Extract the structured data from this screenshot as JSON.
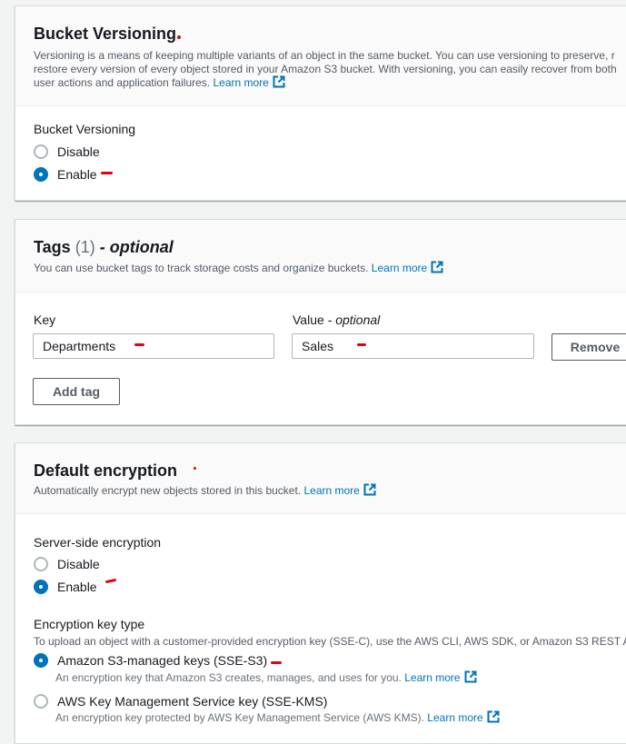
{
  "versioning": {
    "title": "Bucket Versioning",
    "desc_line1": "Versioning is a means of keeping multiple variants of an object in the same bucket. You can use versioning to preserve, r",
    "desc_line2": "restore every version of every object stored in your Amazon S3 bucket. With versioning, you can easily recover from both",
    "desc_line3": "user actions and application failures.",
    "learn_more": "Learn more",
    "field_label": "Bucket Versioning",
    "options": [
      {
        "label": "Disable",
        "checked": false
      },
      {
        "label": "Enable",
        "checked": true
      }
    ]
  },
  "tags": {
    "title": "Tags",
    "count": "(1)",
    "optional": "- optional",
    "desc": "You can use bucket tags to track storage costs and organize buckets.",
    "learn_more": "Learn more",
    "key_label": "Key",
    "value_label": "Value",
    "value_optional": "- optional",
    "key_value": "Departments",
    "value_value": "Sales",
    "remove_label": "Remove",
    "add_tag_label": "Add tag"
  },
  "encryption": {
    "title": "Default encryption",
    "desc": "Automatically encrypt new objects stored in this bucket.",
    "learn_more": "Learn more",
    "sse_label": "Server-side encryption",
    "sse_options": [
      {
        "label": "Disable",
        "checked": false
      },
      {
        "label": "Enable",
        "checked": true
      }
    ],
    "key_type_label": "Encryption key type",
    "key_type_desc": "To upload an object with a customer-provided encryption key (SSE-C), use the AWS CLI, AWS SDK, or Amazon S3 REST A",
    "key_options": [
      {
        "label": "Amazon S3-managed keys (SSE-S3)",
        "desc": "An encryption key that Amazon S3 creates, manages, and uses for you.",
        "learn_more": "Learn more",
        "checked": true
      },
      {
        "label": "AWS Key Management Service key (SSE-KMS)",
        "desc": "An encryption key protected by AWS Key Management Service (AWS KMS).",
        "learn_more": "Learn more",
        "checked": false
      }
    ]
  },
  "colors": {
    "link": "#0073bb",
    "radio_selected": "#0073bb",
    "annotation": "#e3000f"
  }
}
